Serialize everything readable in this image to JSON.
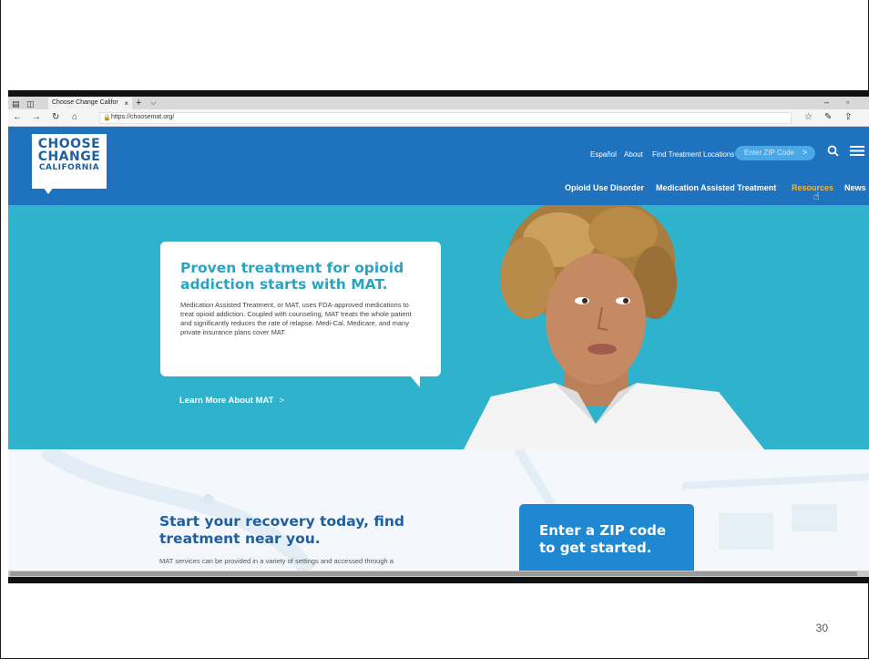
{
  "slide": {
    "number": "30"
  },
  "browser": {
    "tab_title": "Choose Change Califor",
    "tab_close": "×",
    "new_tab": "+",
    "tab_menu": "⌵",
    "url": "https://choosemat.org/",
    "window_controls": {
      "minimize": "–",
      "maximize": "▫"
    }
  },
  "site": {
    "logo": {
      "line1": "CHOOSE",
      "line2": "CHANGE",
      "line3": "CALIFORNIA"
    },
    "utility_nav": [
      "Español",
      "About",
      "Find Treatment Locations"
    ],
    "zip_input_placeholder": "Enter ZIP Code",
    "zip_arrow": ">",
    "main_nav": [
      "Opioid Use Disorder",
      "Medication Assisted Treatment",
      "Resources",
      "News"
    ],
    "active_nav": "Resources",
    "hero": {
      "title": "Proven treatment for opioid addiction starts with MAT.",
      "body": "Medication Assisted Treatment, or MAT, uses FDA-approved medications to treat opioid addiction. Coupled with counseling, MAT treats the whole patient and significantly reduces the rate of relapse. Medi-Cal, Medicare, and many private insurance plans cover MAT.",
      "cta": "Learn More About MAT",
      "cta_chevron": ">"
    },
    "lower": {
      "title": "Start your recovery today, find treatment near you.",
      "body": "MAT services can be provided in a variety of settings and accessed through a",
      "zip_card_title": "Enter a ZIP code to get started."
    }
  },
  "colors": {
    "brand_blue": "#1f72bd",
    "hero_teal": "#2fb2cc",
    "accent_orange": "#f7b33b",
    "zip_card_blue": "#1f88d2"
  }
}
